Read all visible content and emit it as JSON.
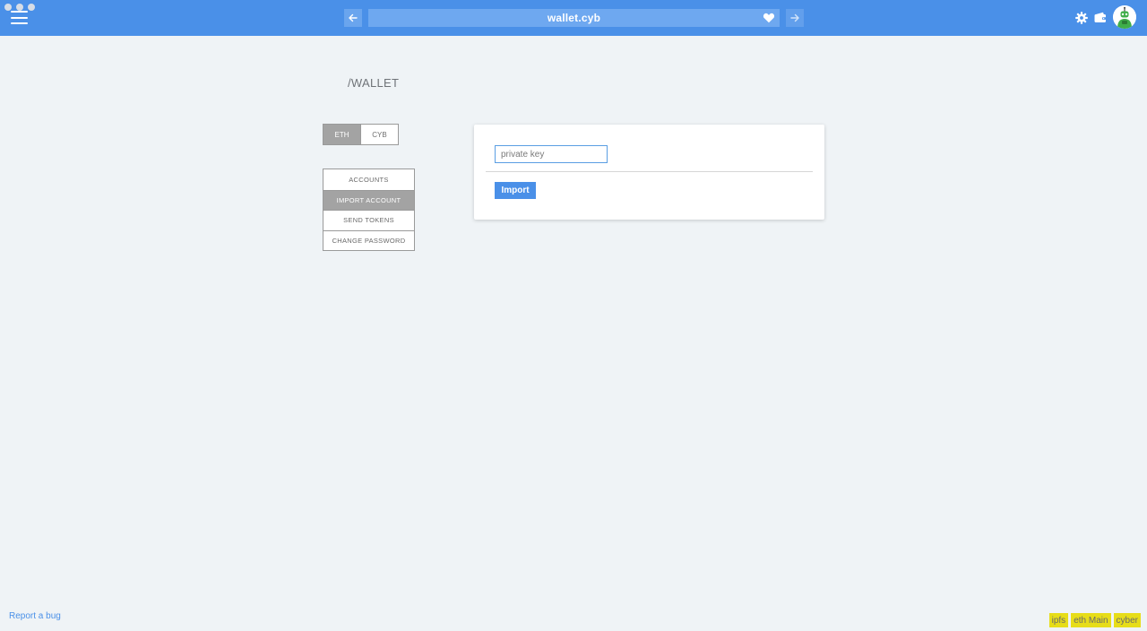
{
  "browser": {
    "url": "wallet.cyb"
  },
  "page": {
    "title": "/WALLET"
  },
  "network_toggle": {
    "options": [
      "ETH",
      "CYB"
    ],
    "selected": "ETH"
  },
  "side_menu": {
    "items": [
      {
        "label": "ACCOUNTS"
      },
      {
        "label": "IMPORT ACCOUNT"
      },
      {
        "label": "SEND TOKENS"
      },
      {
        "label": "CHANGE PASSWORD"
      }
    ],
    "selected": "IMPORT ACCOUNT"
  },
  "import_form": {
    "private_key_placeholder": "private key",
    "private_key_value": "",
    "import_label": "Import"
  },
  "footer": {
    "report_bug": "Report a bug",
    "badges": [
      "ipfs",
      "eth Main",
      "cyber"
    ]
  },
  "colors": {
    "accent": "#4a90e8",
    "badge": "#e7dd18",
    "selected_gray": "#a3a3a3"
  }
}
